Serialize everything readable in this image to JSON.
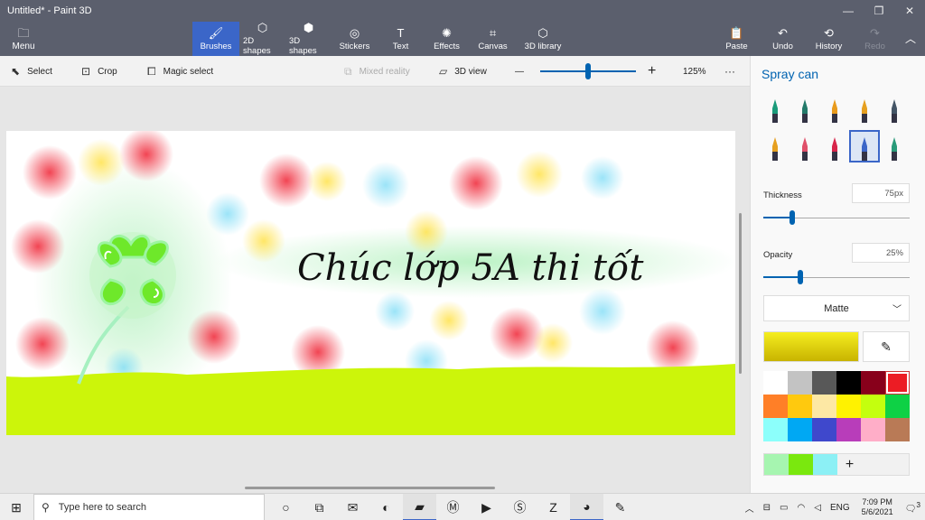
{
  "window": {
    "title": "Untitled* - Paint 3D",
    "minimize": "—",
    "maximize": "❐",
    "close": "✕"
  },
  "menu": {
    "label": "Menu",
    "icon": "folder-icon"
  },
  "ribbon": [
    {
      "label": "Brushes",
      "icon": "brush-icon",
      "active": true
    },
    {
      "label": "2D shapes",
      "icon": "shapes-2d-icon"
    },
    {
      "label": "3D shapes",
      "icon": "cube-icon"
    },
    {
      "label": "Stickers",
      "icon": "sticker-icon"
    },
    {
      "label": "Text",
      "icon": "text-icon"
    },
    {
      "label": "Effects",
      "icon": "effects-icon"
    },
    {
      "label": "Canvas",
      "icon": "canvas-icon"
    },
    {
      "label": "3D library",
      "icon": "library-icon"
    }
  ],
  "ribbon_right": [
    {
      "label": "Paste",
      "icon": "paste-icon"
    },
    {
      "label": "Undo",
      "icon": "undo-icon"
    },
    {
      "label": "History",
      "icon": "history-icon"
    },
    {
      "label": "Redo",
      "icon": "redo-icon",
      "disabled": true
    }
  ],
  "toolbar": {
    "select": "Select",
    "crop": "Crop",
    "magic_select": "Magic select",
    "mixed_reality": "Mixed reality",
    "view_3d": "3D view",
    "zoom": "125%",
    "zoom_level": 0.5,
    "more": "···",
    "zoom_out": "—",
    "zoom_in": "+"
  },
  "canvas": {
    "text": "Chúc lớp 5A thi tốt",
    "ground_color": "#ccf50a",
    "clover_color": "#6ee82a"
  },
  "panel": {
    "title": "Spray can",
    "brushes": [
      {
        "name": "marker",
        "color": "#1a9b7a"
      },
      {
        "name": "calligraphy-pen",
        "color": "#247a6a"
      },
      {
        "name": "oil-brush",
        "color": "#e99b1c"
      },
      {
        "name": "watercolor",
        "color": "#e6a020"
      },
      {
        "name": "pixel-pen",
        "color": "#445566"
      },
      {
        "name": "pencil",
        "color": "#e6a020"
      },
      {
        "name": "eraser",
        "color": "#e0506a"
      },
      {
        "name": "crayon",
        "color": "#d8254a"
      },
      {
        "name": "spray-can",
        "color": "#3b66c8",
        "selected": true
      },
      {
        "name": "fill",
        "color": "#2a9b7a"
      }
    ],
    "thickness_label": "Thickness",
    "thickness_value": "75px",
    "thickness_level": 0.2,
    "opacity_label": "Opacity",
    "opacity_value": "25%",
    "opacity_level": 0.25,
    "finish": "Matte",
    "current_color": "#e8dc10",
    "palette": [
      "#ffffff",
      "#c3c3c3",
      "#585858",
      "#000000",
      "#88001b",
      "#ec1c24",
      "#ff7f27",
      "#ffc90e",
      "#fde8a4",
      "#fff200",
      "#c4ff0e",
      "#0ed145",
      "#8cfffb",
      "#00a8f3",
      "#3f48cc",
      "#b83dba",
      "#ffaec8",
      "#b97a56"
    ],
    "custom_colors": [
      "#a6f5b0",
      "#7ae80e",
      "#8cf0f5"
    ],
    "add_color": "+"
  },
  "taskbar": {
    "search_placeholder": "Type here to search",
    "apps": [
      {
        "name": "cortana-icon",
        "glyph": "○"
      },
      {
        "name": "task-view-icon",
        "glyph": "⧉"
      },
      {
        "name": "mail-icon",
        "glyph": "✉"
      },
      {
        "name": "edge-icon",
        "glyph": "◐"
      },
      {
        "name": "file-explorer-icon",
        "glyph": "▰",
        "active": true
      },
      {
        "name": "app-m-icon",
        "glyph": "Ⓜ"
      },
      {
        "name": "media-player-icon",
        "glyph": "▶"
      },
      {
        "name": "app-s-icon",
        "glyph": "Ⓢ"
      },
      {
        "name": "zalo-icon",
        "glyph": "Z"
      },
      {
        "name": "paint3d-icon",
        "glyph": "◕",
        "active": true
      },
      {
        "name": "paint-icon",
        "glyph": "✎"
      }
    ],
    "language": "ENG",
    "time": "7:09 PM",
    "date": "5/6/2021",
    "notifications": "3"
  }
}
